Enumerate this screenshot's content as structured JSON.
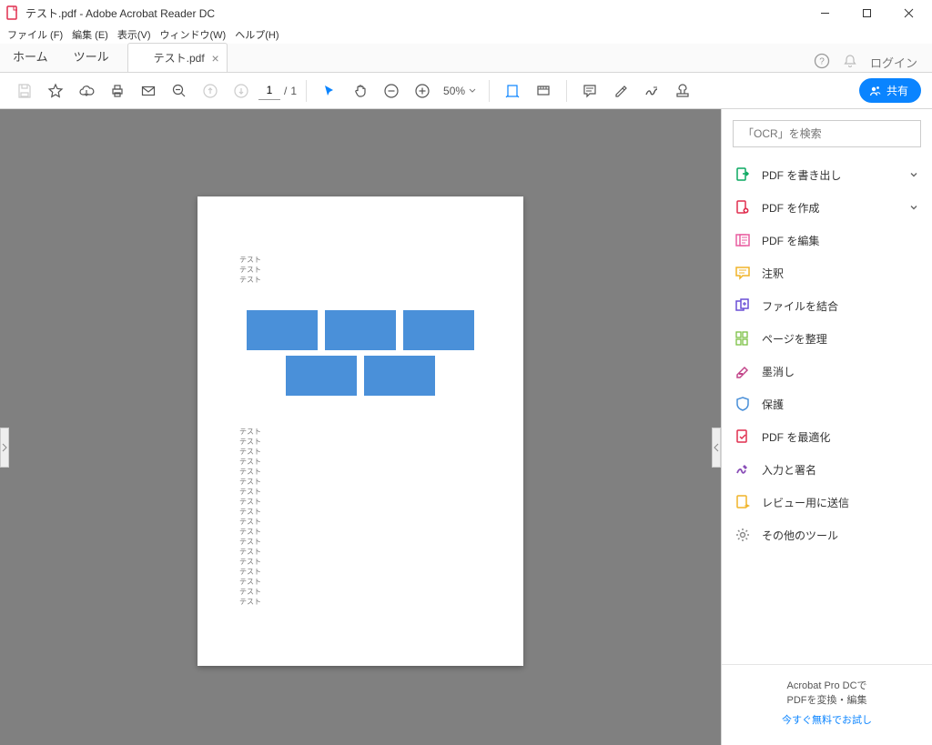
{
  "titlebar": {
    "title": "テスト.pdf - Adobe Acrobat Reader DC"
  },
  "menu": {
    "file": "ファイル (F)",
    "edit": "編集 (E)",
    "view": "表示(V)",
    "window": "ウィンドウ(W)",
    "help": "ヘルプ(H)"
  },
  "tabs": {
    "home": "ホーム",
    "tools": "ツール",
    "doc": "テスト.pdf",
    "login": "ログイン"
  },
  "toolbar": {
    "page_current": "1",
    "page_sep": "/",
    "page_total": "1",
    "zoom": "50%",
    "share": "共有"
  },
  "rpanel": {
    "search_placeholder": "「OCR」を検索",
    "items": [
      {
        "label": "PDF を書き出し",
        "icon": "export",
        "chev": true
      },
      {
        "label": "PDF を作成",
        "icon": "create",
        "chev": true
      },
      {
        "label": "PDF を編集",
        "icon": "edit"
      },
      {
        "label": "注釈",
        "icon": "comment"
      },
      {
        "label": "ファイルを結合",
        "icon": "combine"
      },
      {
        "label": "ページを整理",
        "icon": "organize"
      },
      {
        "label": "墨消し",
        "icon": "redact"
      },
      {
        "label": "保護",
        "icon": "protect"
      },
      {
        "label": "PDF を最適化",
        "icon": "optimize"
      },
      {
        "label": "入力と署名",
        "icon": "sign"
      },
      {
        "label": "レビュー用に送信",
        "icon": "send"
      },
      {
        "label": "その他のツール",
        "icon": "more"
      }
    ],
    "promo_line1": "Acrobat Pro DCで",
    "promo_line2": "PDFを変換・編集",
    "promo_link": "今すぐ無料でお試し"
  },
  "page_content": {
    "top_lines": [
      "テスト",
      "テスト",
      "テスト"
    ],
    "bottom_lines": [
      "テスト",
      "テスト",
      "テスト",
      "テスト",
      "テスト",
      "テスト",
      "テスト",
      "テスト",
      "テスト",
      "テスト",
      "テスト",
      "テスト",
      "テスト",
      "テスト",
      "テスト",
      "テスト",
      "テスト",
      "テスト"
    ]
  },
  "icon_colors": {
    "export": "#0aa860",
    "create": "#e02e4f",
    "edit": "#e95ea0",
    "comment": "#f0b429",
    "combine": "#6a4fd6",
    "organize": "#7bc043",
    "redact": "#c2468a",
    "protect": "#4a90d9",
    "optimize": "#e02e4f",
    "sign": "#8a4fb8",
    "send": "#f0b429",
    "more": "#888"
  }
}
